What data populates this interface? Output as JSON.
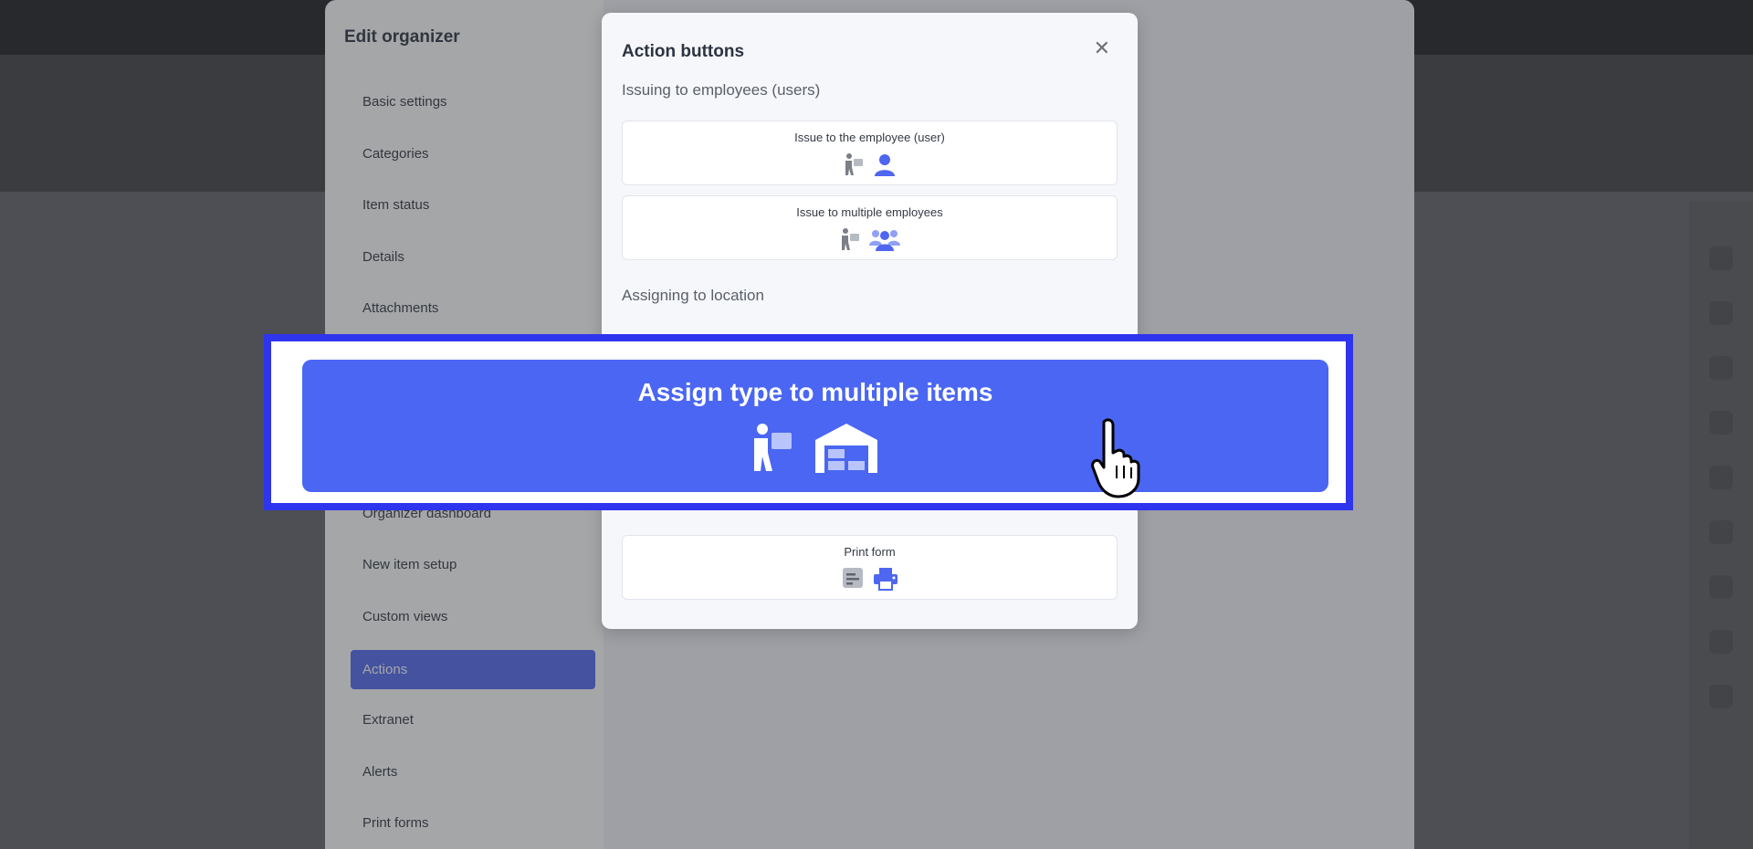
{
  "background": {
    "dots": 9
  },
  "organizer": {
    "title": "Edit organizer",
    "close_symbol": "✕",
    "nav": [
      {
        "label": "Basic settings",
        "active": false
      },
      {
        "label": "Categories",
        "active": false
      },
      {
        "label": "Item status",
        "active": false
      },
      {
        "label": "Details",
        "active": false
      },
      {
        "label": "Attachments",
        "active": false
      },
      {
        "label": "Organizer dashboard",
        "active": false
      },
      {
        "label": "New item setup",
        "active": false
      },
      {
        "label": "Custom views",
        "active": false
      },
      {
        "label": "Actions",
        "active": true
      },
      {
        "label": "Extranet",
        "active": false
      },
      {
        "label": "Alerts",
        "active": false
      },
      {
        "label": "Print forms",
        "active": false
      }
    ]
  },
  "dialog": {
    "title": "Action buttons",
    "close_symbol": "✕",
    "section_issuing": "Issuing to employees (users)",
    "section_location": "Assigning to location",
    "buttons": {
      "issue_employee": "Issue to the employee (user)",
      "issue_multiple": "Issue to multiple employees",
      "print_form": "Print form"
    }
  },
  "highlight": {
    "label": "Assign type to multiple items"
  },
  "colors": {
    "accent": "#4f66f0",
    "highlight_border": "#2f34ee",
    "highlight_button": "#4a66f2",
    "icon_gray": "#7a7f88",
    "icon_blue": "#4f66f0"
  },
  "icons": {
    "person_with_box": "person-carrying-box-icon",
    "user": "user-icon",
    "users": "users-group-icon",
    "warehouse": "warehouse-icon",
    "form": "form-document-icon",
    "printer": "printer-icon",
    "edit": "pencil-icon",
    "trash": "trash-icon",
    "cursor": "hand-pointer-cursor-icon"
  }
}
